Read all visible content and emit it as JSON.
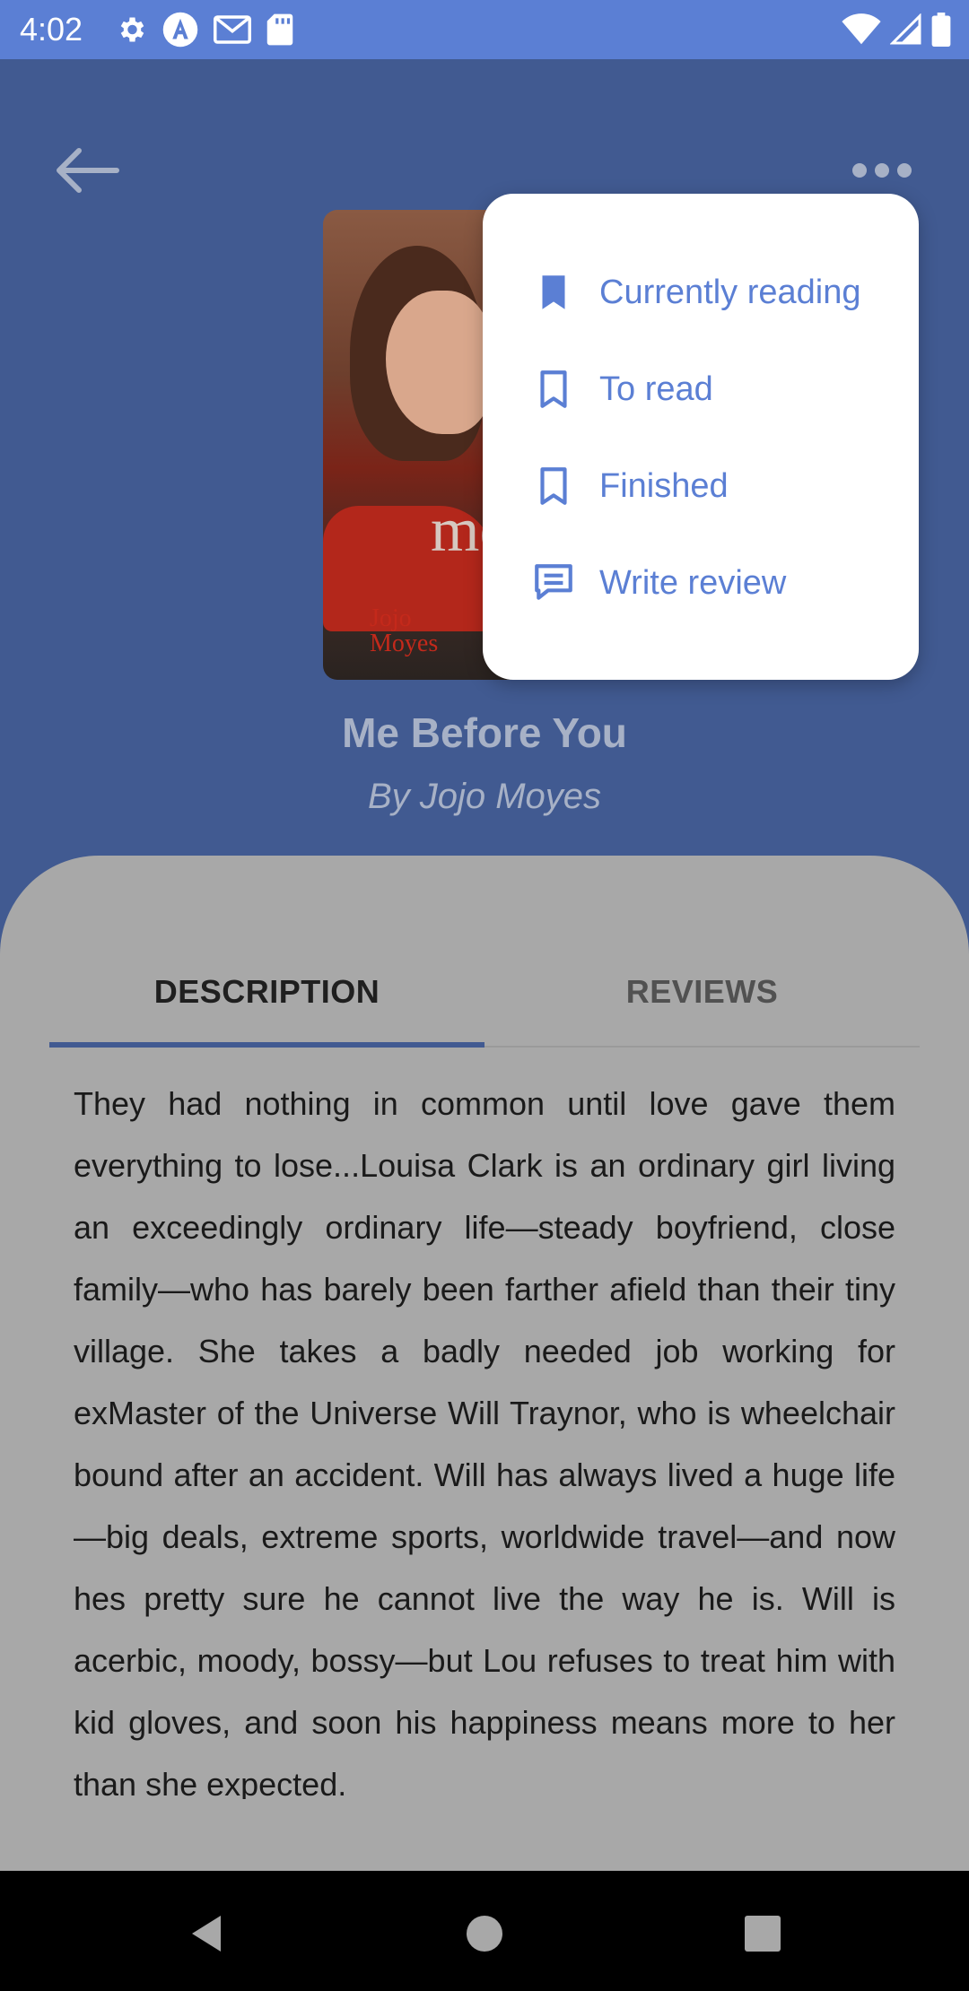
{
  "status_bar": {
    "time": "4:02",
    "left_icons": [
      "settings-icon",
      "a-circle-icon",
      "gmail-icon",
      "sd-card-icon"
    ],
    "right_icons": [
      "wifi-icon",
      "signal-icon",
      "battery-icon"
    ]
  },
  "header": {
    "back_icon": "arrow-left-icon",
    "more_icon": "more-horizontal-icon"
  },
  "book": {
    "cover_author_line1": "Jojo",
    "cover_author_line2": "Moyes",
    "cover_title_fragment": "me",
    "title": "Me Before You",
    "author": "By Jojo Moyes"
  },
  "tabs": [
    {
      "label": "DESCRIPTION",
      "selected": true
    },
    {
      "label": "REVIEWS",
      "selected": false
    }
  ],
  "description": "They had nothing in common until love gave them everything to lose...Louisa Clark is an ordinary girl living an exceedingly ordinary life—steady boyfriend, close family—who has barely been farther afield than their tiny village. She takes a badly needed job working for exMaster of the Universe Will Traynor, who is wheelchair bound after an accident. Will has always lived a huge life—big deals, extreme sports, worldwide travel—and now hes pretty sure he cannot live the way he is. Will is acerbic, moody, bossy—but Lou refuses to treat him with kid gloves, and soon his happiness means more to her than she expected.",
  "menu": {
    "items": [
      {
        "label": "Currently reading",
        "icon": "bookmark-filled-icon"
      },
      {
        "label": "To read",
        "icon": "bookmark-outline-icon"
      },
      {
        "label": "Finished",
        "icon": "bookmark-outline-icon"
      },
      {
        "label": "Write review",
        "icon": "review-icon"
      }
    ]
  },
  "colors": {
    "accent": "#5b7fd4",
    "header_dimmed": "#415a91",
    "sheet_dimmed": "#a8a8a8"
  },
  "nav_bar": {
    "icons": [
      "nav-back-icon",
      "nav-home-icon",
      "nav-recents-icon"
    ]
  }
}
